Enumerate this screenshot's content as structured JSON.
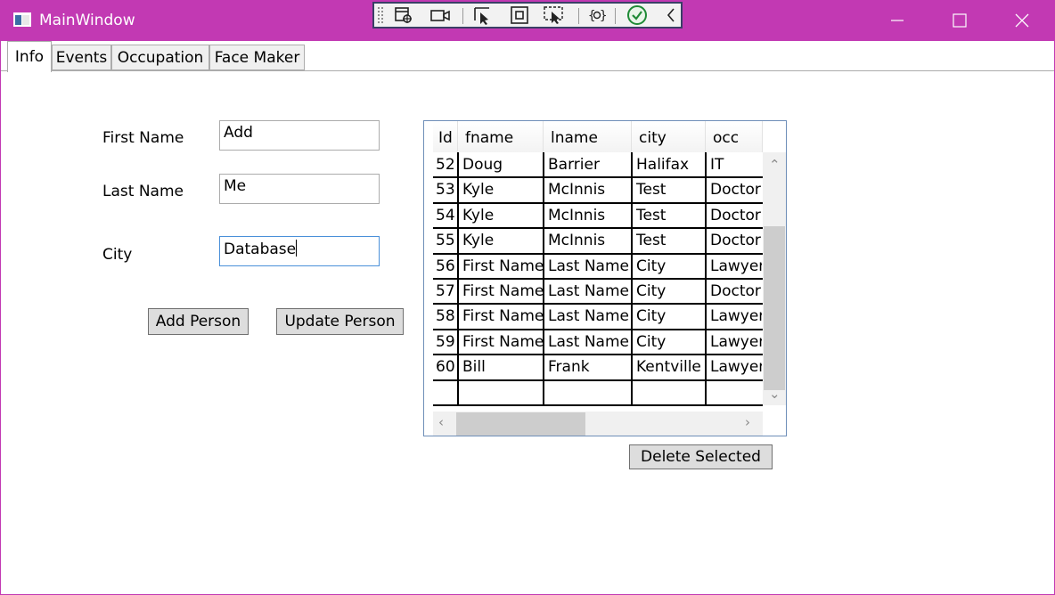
{
  "window": {
    "title": "MainWindow"
  },
  "tabs": [
    "Info",
    "Events",
    "Occupation",
    "Face Maker"
  ],
  "form": {
    "first_name_label": "First Name",
    "first_name_value": "Add",
    "last_name_label": "Last Name",
    "last_name_value": "Me",
    "city_label": "City",
    "city_value": "Database",
    "add_button": "Add Person",
    "update_button": "Update Person"
  },
  "grid": {
    "columns": [
      "Id",
      "fname",
      "lname",
      "city",
      "occ"
    ],
    "rows": [
      [
        "52",
        "Doug",
        "Barrier",
        "Halifax",
        "IT"
      ],
      [
        "53",
        "Kyle",
        "McInnis",
        "Test",
        "Doctor"
      ],
      [
        "54",
        "Kyle",
        "McInnis",
        "Test",
        "Doctor"
      ],
      [
        "55",
        "Kyle",
        "McInnis",
        "Test",
        "Doctor"
      ],
      [
        "56",
        "First Name",
        "Last Name",
        "City",
        "Lawyer"
      ],
      [
        "57",
        "First Name",
        "Last Name",
        "City",
        "Doctor"
      ],
      [
        "58",
        "First Name",
        "Last Name",
        "City",
        "Lawyer"
      ],
      [
        "59",
        "First Name",
        "Last Name",
        "City",
        "Lawyer"
      ],
      [
        "60",
        "Bill",
        "Frank",
        "Kentville",
        "Lawyer"
      ]
    ],
    "delete_button": "Delete Selected"
  },
  "colors": {
    "titlebar": "#c239b3",
    "debugbar_border": "#3a3f66",
    "grid_border": "#6e8eb8"
  }
}
